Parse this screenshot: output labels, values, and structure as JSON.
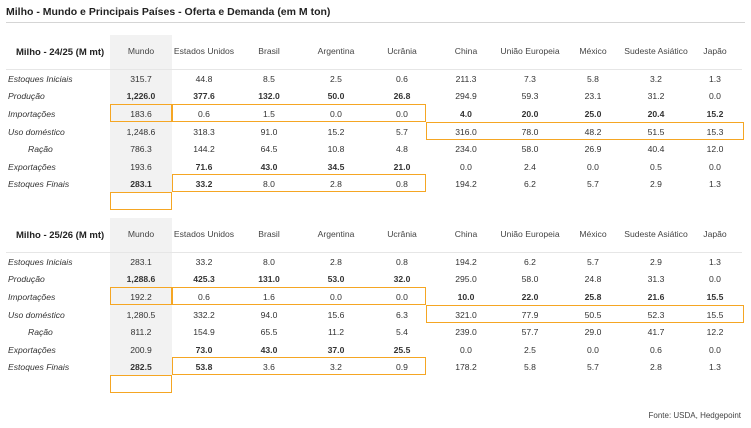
{
  "title": "Milho - Mundo e Principais Países - Oferta e Demanda (em M ton)",
  "source": "Fonte: USDA, Hedgepoint",
  "colors": {
    "highlight_orange": "#f39a1e",
    "highlight_red": "#d8232a",
    "highlight_blue": "#3a3ec4"
  },
  "columns": [
    "Mundo",
    "Estados Unidos",
    "Brasil",
    "Argentina",
    "Ucrânia",
    "China",
    "União Europeia",
    "México",
    "Sudeste Asiático",
    "Japão"
  ],
  "sections": [
    {
      "label": "Milho - 24/25 (M mt)",
      "rows": [
        {
          "label": "Estoques Iniciais",
          "values": [
            "315.7",
            "44.8",
            "8.5",
            "2.5",
            "0.6",
            "211.3",
            "7.3",
            "5.8",
            "3.2",
            "1.3"
          ]
        },
        {
          "label": "Produção",
          "values": [
            "1,226.0",
            "377.6",
            "132.0",
            "50.0",
            "26.8",
            "294.9",
            "59.3",
            "23.1",
            "31.2",
            "0.0"
          ]
        },
        {
          "label": "Importações",
          "values": [
            "183.6",
            "0.6",
            "1.5",
            "0.0",
            "0.0",
            "4.0",
            "20.0",
            "25.0",
            "20.4",
            "15.2"
          ]
        },
        {
          "label": "Uso doméstico",
          "values": [
            "1,248.6",
            "318.3",
            "91.0",
            "15.2",
            "5.7",
            "316.0",
            "78.0",
            "48.2",
            "51.5",
            "15.3"
          ]
        },
        {
          "label": "Ração",
          "values": [
            "786.3",
            "144.2",
            "64.5",
            "10.8",
            "4.8",
            "234.0",
            "58.0",
            "26.9",
            "40.4",
            "12.0"
          ]
        },
        {
          "label": "Exportações",
          "values": [
            "193.6",
            "71.6",
            "43.0",
            "34.5",
            "21.0",
            "0.0",
            "2.4",
            "0.0",
            "0.5",
            "0.0"
          ]
        },
        {
          "label": "Estoques Finais",
          "values": [
            "283.1",
            "33.2",
            "8.0",
            "2.8",
            "0.8",
            "194.2",
            "6.2",
            "5.7",
            "2.9",
            "1.3"
          ]
        }
      ]
    },
    {
      "label": "Milho - 25/26 (M mt)",
      "rows": [
        {
          "label": "Estoques Iniciais",
          "values": [
            "283.1",
            "33.2",
            "8.0",
            "2.8",
            "0.8",
            "194.2",
            "6.2",
            "5.7",
            "2.9",
            "1.3"
          ]
        },
        {
          "label": "Produção",
          "values": [
            "1,288.6",
            "425.3",
            "131.0",
            "53.0",
            "32.0",
            "295.0",
            "58.0",
            "24.8",
            "31.3",
            "0.0"
          ]
        },
        {
          "label": "Importações",
          "values": [
            "192.2",
            "0.6",
            "1.6",
            "0.0",
            "0.0",
            "10.0",
            "22.0",
            "25.8",
            "21.6",
            "15.5"
          ]
        },
        {
          "label": "Uso doméstico",
          "values": [
            "1,280.5",
            "332.2",
            "94.0",
            "15.6",
            "6.3",
            "321.0",
            "77.9",
            "50.5",
            "52.3",
            "15.5"
          ]
        },
        {
          "label": "Ração",
          "values": [
            "811.2",
            "154.9",
            "65.5",
            "11.2",
            "5.4",
            "239.0",
            "57.7",
            "29.0",
            "41.7",
            "12.2"
          ]
        },
        {
          "label": "Exportações",
          "values": [
            "200.9",
            "73.0",
            "43.0",
            "37.0",
            "25.5",
            "0.0",
            "2.5",
            "0.0",
            "0.6",
            "0.0"
          ]
        },
        {
          "label": "Estoques Finais",
          "values": [
            "282.5",
            "53.8",
            "3.6",
            "3.2",
            "0.9",
            "178.2",
            "5.8",
            "5.7",
            "2.8",
            "1.3"
          ]
        }
      ]
    }
  ]
}
